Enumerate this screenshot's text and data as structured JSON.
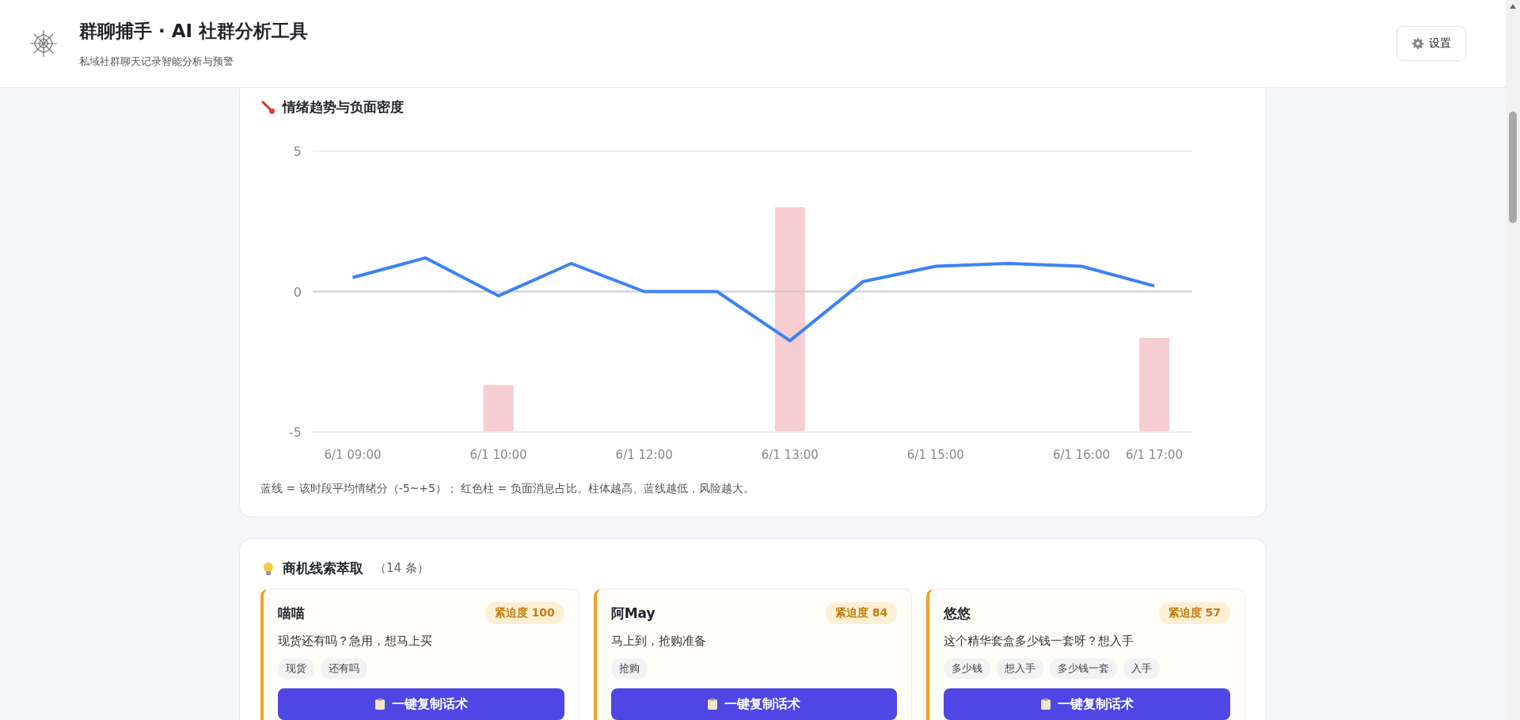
{
  "header": {
    "title": "群聊捕手 · AI 社群分析工具",
    "subtitle": "私域社群聊天记录智能分析与预警",
    "settings_button": "设置"
  },
  "trend_panel": {
    "title": "情绪趋势与负面密度",
    "caption": "蓝线 = 该时段平均情绪分（-5~+5）； 红色柱 = 负面消息占比。柱体越高、蓝线越低，风险越大。",
    "chart_data": {
      "type": "line",
      "categories": [
        "6/1 09:00",
        null,
        "6/1 10:00",
        null,
        "6/1 12:00",
        null,
        "6/1 13:00",
        null,
        "6/1 15:00",
        null,
        "6/1 16:00",
        "6/1 17:00"
      ],
      "ylim": [
        -5,
        5
      ],
      "yticks": [
        -5,
        0,
        5
      ],
      "series": [
        {
          "color": "#3b82f6",
          "values": [
            0.5,
            1.2,
            -0.15,
            1.0,
            0,
            0,
            -1.75,
            0.35,
            0.9,
            1.0,
            0.9,
            0.2
          ]
        }
      ]
    }
  },
  "leads_panel": {
    "title": "商机线索萃取",
    "count": "（14 条）",
    "leads": [
      {
        "name": "喵喵",
        "urgency": "紧迫度 100",
        "message": "现货还有吗？急用，想马上买",
        "tags": [
          "现货",
          "还有吗"
        ],
        "action": "一键复制话术"
      },
      {
        "name": "阿May",
        "urgency": "紧迫度 84",
        "message": "马上到，抢购准备",
        "tags": [
          "抢购"
        ],
        "action": "一键复制话术"
      },
      {
        "name": "悠悠",
        "urgency": "紧迫度 57",
        "message": "这个精华套盒多少钱一套呀？想入手",
        "tags": [
          "多少钱",
          "想入手",
          "多少钱一套",
          "入手"
        ],
        "action": "一键复制话术"
      }
    ]
  }
}
